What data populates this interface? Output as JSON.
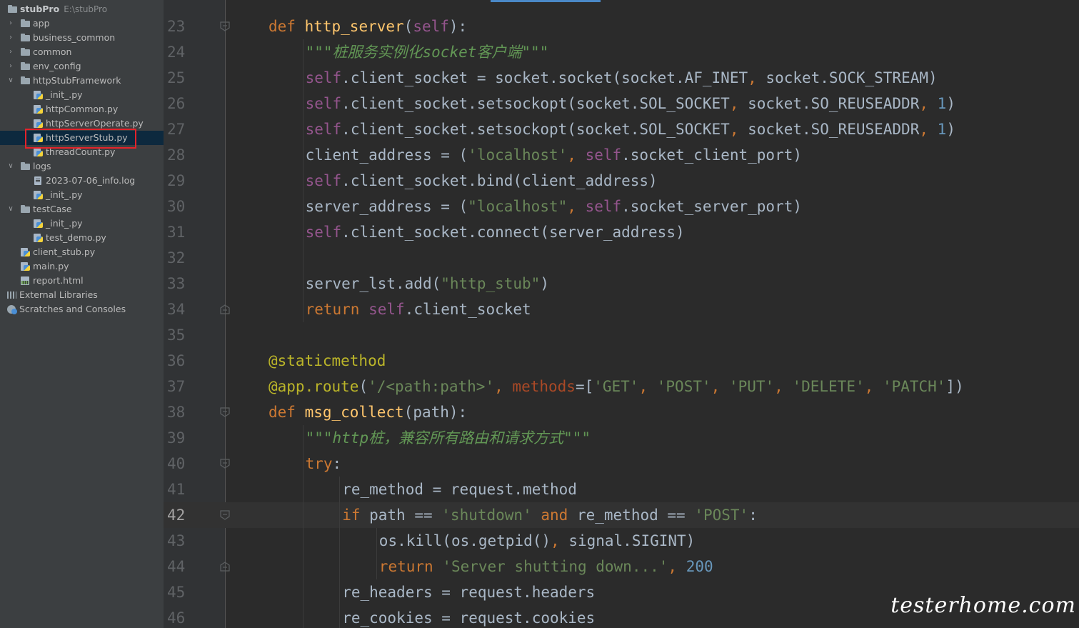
{
  "project": {
    "name": "stubPro",
    "path": "E:\\stubPro",
    "tree": [
      {
        "label": "app",
        "icon": "folder-icon",
        "indent": 1,
        "expand": "collapsed"
      },
      {
        "label": "business_common",
        "icon": "folder-icon",
        "indent": 1,
        "expand": "collapsed"
      },
      {
        "label": "common",
        "icon": "folder-icon",
        "indent": 1,
        "expand": "collapsed"
      },
      {
        "label": "env_config",
        "icon": "folder-icon",
        "indent": 1,
        "expand": "collapsed"
      },
      {
        "label": "httpStubFramework",
        "icon": "folder-icon",
        "indent": 1,
        "expand": "expanded"
      },
      {
        "label": "_init_.py",
        "icon": "python-file-icon",
        "indent": 2
      },
      {
        "label": "httpCommon.py",
        "icon": "python-file-icon",
        "indent": 2
      },
      {
        "label": "httpServerOperate.py",
        "icon": "python-file-icon",
        "indent": 2
      },
      {
        "label": "httpServerStub.py",
        "icon": "python-file-icon",
        "indent": 2,
        "selected": true
      },
      {
        "label": "threadCount.py",
        "icon": "python-file-icon",
        "indent": 2
      },
      {
        "label": "logs",
        "icon": "folder-icon",
        "indent": 1,
        "expand": "expanded"
      },
      {
        "label": "2023-07-06_info.log",
        "icon": "log-file-icon",
        "indent": 2
      },
      {
        "label": "_init_.py",
        "icon": "python-file-icon",
        "indent": 2
      },
      {
        "label": "testCase",
        "icon": "folder-icon",
        "indent": 1,
        "expand": "expanded"
      },
      {
        "label": "_init_.py",
        "icon": "python-file-icon",
        "indent": 2
      },
      {
        "label": "test_demo.py",
        "icon": "python-file-icon",
        "indent": 2
      },
      {
        "label": "client_stub.py",
        "icon": "python-file-icon",
        "indent": 1
      },
      {
        "label": "main.py",
        "icon": "python-file-icon",
        "indent": 1
      },
      {
        "label": "report.html",
        "icon": "html-file-icon",
        "indent": 1
      },
      {
        "label": "External Libraries",
        "icon": "library-icon",
        "indent": 0
      },
      {
        "label": "Scratches and Consoles",
        "icon": "scratch-icon",
        "indent": 0
      }
    ]
  },
  "colors": {
    "keyword": "#cc7832",
    "self": "#94558d",
    "function": "#ffc66d",
    "string": "#6a8759",
    "number": "#6897bb",
    "decorator": "#bbb529",
    "param": "#aa4926",
    "text": "#a9b7c6",
    "docstring": "#629755",
    "selection_border": "#e3232b"
  },
  "editor": {
    "current_line": 42,
    "lines": [
      {
        "n": "23",
        "indent": 1,
        "tokens": [
          [
            "def",
            "keyword"
          ],
          [
            " ",
            "text"
          ],
          [
            "http_server",
            "function"
          ],
          [
            "(",
            "text"
          ],
          [
            "self",
            "self"
          ],
          [
            "):",
            "text"
          ]
        ],
        "fold": "open"
      },
      {
        "n": "24",
        "indent": 2,
        "tokens": [
          [
            "\"\"\"桩服务实例化socket客户端\"\"\"",
            "docstring"
          ]
        ]
      },
      {
        "n": "25",
        "indent": 2,
        "tokens": [
          [
            "self",
            "self"
          ],
          [
            ".client_socket = socket.socket(socket.AF_INET",
            "text"
          ],
          [
            ",",
            "keyword"
          ],
          [
            " socket.SOCK_STREAM)",
            "text"
          ]
        ]
      },
      {
        "n": "26",
        "indent": 2,
        "tokens": [
          [
            "self",
            "self"
          ],
          [
            ".client_socket.setsockopt(socket.SOL_SOCKET",
            "text"
          ],
          [
            ",",
            "keyword"
          ],
          [
            " socket.SO_REUSEADDR",
            "text"
          ],
          [
            ",",
            "keyword"
          ],
          [
            " ",
            "text"
          ],
          [
            "1",
            "number"
          ],
          [
            ")",
            "text"
          ]
        ]
      },
      {
        "n": "27",
        "indent": 2,
        "tokens": [
          [
            "self",
            "self"
          ],
          [
            ".client_socket.setsockopt(socket.SOL_SOCKET",
            "text"
          ],
          [
            ",",
            "keyword"
          ],
          [
            " socket.SO_REUSEADDR",
            "text"
          ],
          [
            ",",
            "keyword"
          ],
          [
            " ",
            "text"
          ],
          [
            "1",
            "number"
          ],
          [
            ")",
            "text"
          ]
        ]
      },
      {
        "n": "28",
        "indent": 2,
        "tokens": [
          [
            "client_address = (",
            "text"
          ],
          [
            "'localhost'",
            "string"
          ],
          [
            ",",
            "keyword"
          ],
          [
            " ",
            "text"
          ],
          [
            "self",
            "self"
          ],
          [
            ".socket_client_port)",
            "text"
          ]
        ]
      },
      {
        "n": "29",
        "indent": 2,
        "tokens": [
          [
            "self",
            "self"
          ],
          [
            ".client_socket.bind(client_address)",
            "text"
          ]
        ]
      },
      {
        "n": "30",
        "indent": 2,
        "tokens": [
          [
            "server_address = (",
            "text"
          ],
          [
            "\"localhost\"",
            "string"
          ],
          [
            ",",
            "keyword"
          ],
          [
            " ",
            "text"
          ],
          [
            "self",
            "self"
          ],
          [
            ".socket_server_port)",
            "text"
          ]
        ]
      },
      {
        "n": "31",
        "indent": 2,
        "tokens": [
          [
            "self",
            "self"
          ],
          [
            ".client_socket.connect(server_address)",
            "text"
          ]
        ]
      },
      {
        "n": "32",
        "indent": 2,
        "tokens": []
      },
      {
        "n": "33",
        "indent": 2,
        "tokens": [
          [
            "server_lst.add(",
            "text"
          ],
          [
            "\"http_stub\"",
            "string"
          ],
          [
            ")",
            "text"
          ]
        ]
      },
      {
        "n": "34",
        "indent": 2,
        "tokens": [
          [
            "return",
            "keyword"
          ],
          [
            " ",
            "text"
          ],
          [
            "self",
            "self"
          ],
          [
            ".client_socket",
            "text"
          ]
        ],
        "fold": "close"
      },
      {
        "n": "35",
        "indent": 1,
        "tokens": []
      },
      {
        "n": "36",
        "indent": 1,
        "tokens": [
          [
            "@staticmethod",
            "decorator"
          ]
        ]
      },
      {
        "n": "37",
        "indent": 1,
        "tokens": [
          [
            "@app.route",
            "decorator"
          ],
          [
            "(",
            "text"
          ],
          [
            "'/<path:path>'",
            "string"
          ],
          [
            ",",
            "keyword"
          ],
          [
            " ",
            "text"
          ],
          [
            "methods",
            "param"
          ],
          [
            "=[",
            "text"
          ],
          [
            "'GET'",
            "string"
          ],
          [
            ",",
            "keyword"
          ],
          [
            " ",
            "text"
          ],
          [
            "'POST'",
            "string"
          ],
          [
            ",",
            "keyword"
          ],
          [
            " ",
            "text"
          ],
          [
            "'PUT'",
            "string"
          ],
          [
            ",",
            "keyword"
          ],
          [
            " ",
            "text"
          ],
          [
            "'DELETE'",
            "string"
          ],
          [
            ",",
            "keyword"
          ],
          [
            " ",
            "text"
          ],
          [
            "'PATCH'",
            "string"
          ],
          [
            "])",
            "text"
          ]
        ]
      },
      {
        "n": "38",
        "indent": 1,
        "tokens": [
          [
            "def",
            "keyword"
          ],
          [
            " ",
            "text"
          ],
          [
            "msg_collect",
            "function"
          ],
          [
            "(path):",
            "text"
          ]
        ],
        "fold": "open"
      },
      {
        "n": "39",
        "indent": 2,
        "tokens": [
          [
            "\"\"\"http桩，兼容所有路由和请求方式\"\"\"",
            "docstring"
          ]
        ]
      },
      {
        "n": "40",
        "indent": 2,
        "tokens": [
          [
            "try",
            "keyword"
          ],
          [
            ":",
            "text"
          ]
        ],
        "fold": "open"
      },
      {
        "n": "41",
        "indent": 3,
        "tokens": [
          [
            "re_method = request.method",
            "text"
          ]
        ]
      },
      {
        "n": "42",
        "indent": 3,
        "tokens": [
          [
            "if",
            "keyword"
          ],
          [
            " path == ",
            "text"
          ],
          [
            "'shutdown'",
            "string"
          ],
          [
            " ",
            "text"
          ],
          [
            "and",
            "keyword"
          ],
          [
            " re_method == ",
            "text"
          ],
          [
            "'POST'",
            "string"
          ],
          [
            ":",
            "text"
          ]
        ],
        "fold": "open"
      },
      {
        "n": "43",
        "indent": 4,
        "tokens": [
          [
            "os.kill(os.getpid()",
            "text"
          ],
          [
            ",",
            "keyword"
          ],
          [
            " signal.SIGINT)",
            "text"
          ]
        ]
      },
      {
        "n": "44",
        "indent": 4,
        "tokens": [
          [
            "return",
            "keyword"
          ],
          [
            " ",
            "text"
          ],
          [
            "'Server shutting down...'",
            "string"
          ],
          [
            ",",
            "keyword"
          ],
          [
            " ",
            "text"
          ],
          [
            "200",
            "number"
          ]
        ],
        "fold": "close"
      },
      {
        "n": "45",
        "indent": 3,
        "tokens": [
          [
            "re_headers = request.headers",
            "text"
          ]
        ]
      },
      {
        "n": "46",
        "indent": 3,
        "tokens": [
          [
            "re_cookies = request.cookies",
            "text"
          ]
        ]
      }
    ]
  },
  "watermark": "testerhome.com"
}
